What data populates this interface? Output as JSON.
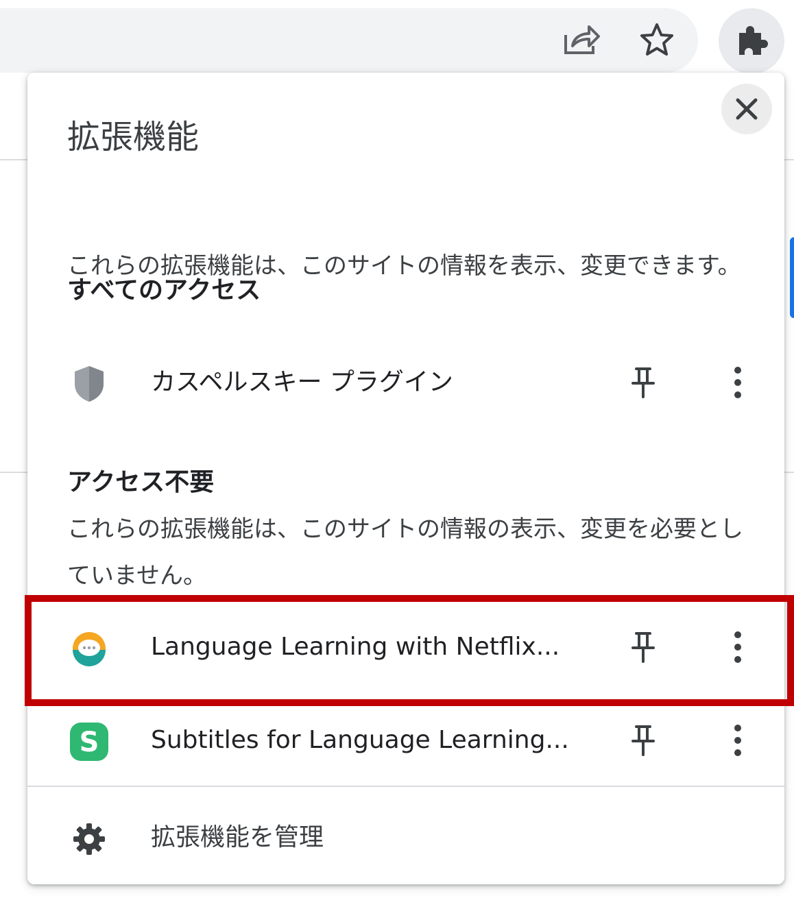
{
  "toolbar": {
    "share_icon": "share-icon",
    "bookmark_icon": "star-icon",
    "extensions_icon": "puzzle-icon"
  },
  "popup": {
    "title": "拡張機能",
    "close_icon": "close-icon",
    "sections": [
      {
        "heading": "すべてのアクセス",
        "description": "これらの拡張機能は、このサイトの情報を表示、変更できます。",
        "extensions": [
          {
            "name": "カスペルスキー プラグイン",
            "icon": "shield-icon"
          }
        ]
      },
      {
        "heading": "アクセス不要",
        "description": "これらの拡張機能は、このサイトの情報の表示、変更を必要としていません。",
        "extensions": [
          {
            "name": "Language Learning with Netflix...",
            "icon": "chat-bubble-icon"
          },
          {
            "name": "Subtitles for Language Learning...",
            "icon": "letter-s-icon"
          }
        ]
      }
    ],
    "manage_label": "拡張機能を管理",
    "manage_icon": "gear-icon"
  },
  "colors": {
    "highlight": "#c00000",
    "omnibox_bg": "#f1f3f4",
    "subtitle_green": "#2eb872"
  }
}
